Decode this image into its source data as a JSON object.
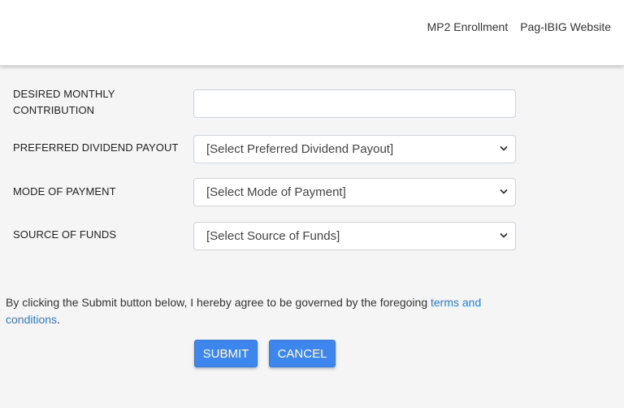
{
  "nav": {
    "items": [
      "MP2 Enrollment",
      "Pag-IBIG Website"
    ]
  },
  "form": {
    "fields": [
      {
        "label_line1": "DESIRED MONTHLY",
        "label_line2": "CONTRIBUTION",
        "value": "",
        "placeholder": ""
      },
      {
        "label": "PREFERRED DIVIDEND PAYOUT",
        "selected": "[Select Preferred Dividend Payout]"
      },
      {
        "label": "MODE OF PAYMENT",
        "selected": "[Select Mode of Payment]"
      },
      {
        "label": "SOURCE OF FUNDS",
        "selected": "[Select Source of Funds]"
      }
    ]
  },
  "agreement": {
    "text": "By clicking the Submit button below, I hereby agree to be governed by the foregoing ",
    "link": "terms and conditions",
    "end": "."
  },
  "buttons": {
    "submit": "SUBMIT",
    "cancel": "CANCEL"
  },
  "colors": {
    "primary_button": "#3d86ee",
    "link": "#2a7bd6",
    "page_background": "#f5f5f5",
    "header_background": "#ffffff"
  }
}
